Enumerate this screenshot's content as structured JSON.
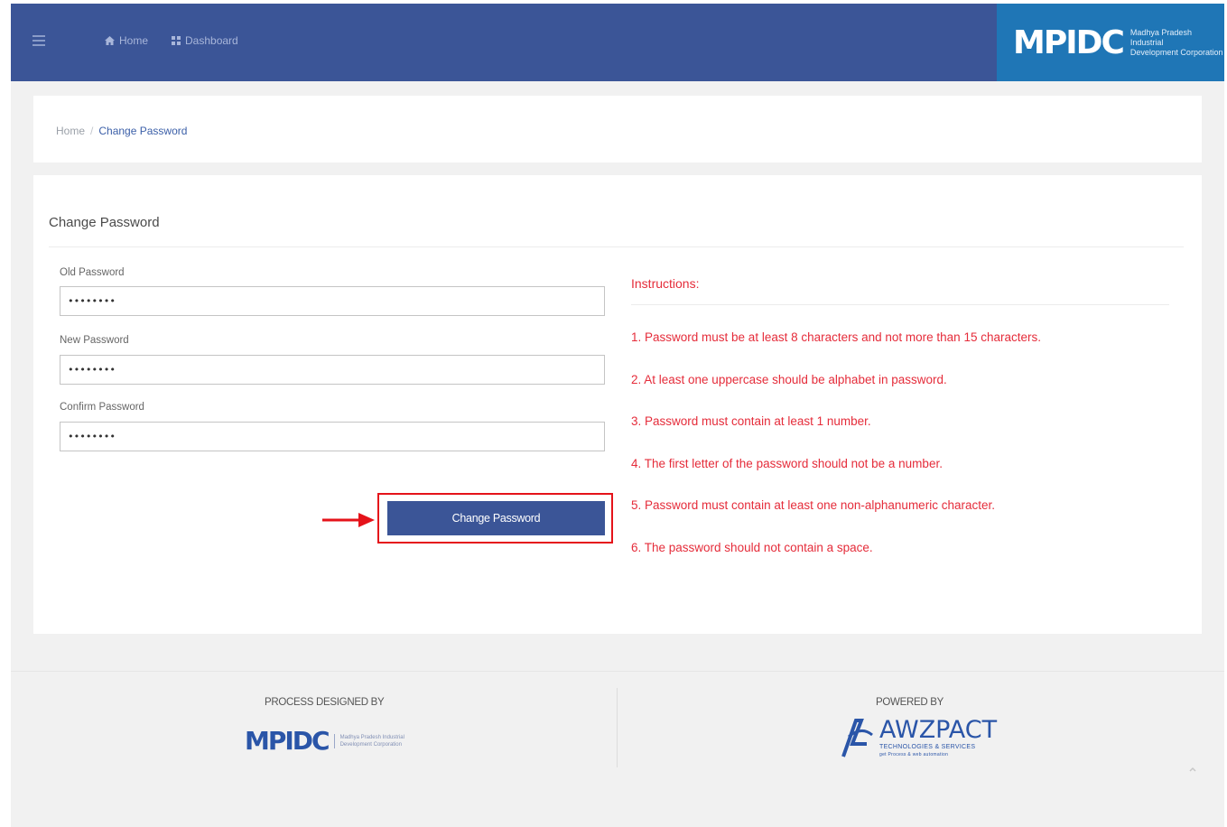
{
  "header": {
    "nav": [
      {
        "label": "Home",
        "icon": "home-icon"
      },
      {
        "label": "Dashboard",
        "icon": "grid-icon"
      }
    ],
    "brand": {
      "logo_text": "MPIDC",
      "line1": "Madhya Pradesh Industrial",
      "line2": "Development Corporation"
    },
    "colors": {
      "bar": "#3b5597",
      "brand_bg": "#1f76b6"
    }
  },
  "breadcrumb": {
    "home": "Home",
    "separator": "/",
    "current": "Change Password"
  },
  "form": {
    "title": "Change Password",
    "fields": [
      {
        "label": "Old Password",
        "value": "••••••••"
      },
      {
        "label": "New Password",
        "value": "••••••••"
      },
      {
        "label": "Confirm Password",
        "value": "••••••••"
      }
    ],
    "submit_label": "Change Password",
    "highlight_color": "#e5131a"
  },
  "instructions": {
    "title": "Instructions:",
    "color": "#e52c3a",
    "items": [
      "1. Password must be at least 8 characters and not more than 15 characters.",
      "2. At least one uppercase should be alphabet in password.",
      "3. Password must contain at least 1 number.",
      "4. The first letter of the password should not be a number.",
      "5. Password must contain at least one non-alphanumeric character.",
      "6. The password should not contain a space."
    ]
  },
  "footer": {
    "process_label": "PROCESS DESIGNED BY",
    "powered_label": "POWERED BY",
    "mpidc": {
      "logo_text": "MPIDC",
      "line1": "Madhya Pradesh Industrial",
      "line2": "Development Corporation"
    },
    "awzpact": {
      "name": "AWZPACT",
      "tagline": "TECHNOLOGIES & SERVICES",
      "sub": "get Process & web automation"
    }
  }
}
